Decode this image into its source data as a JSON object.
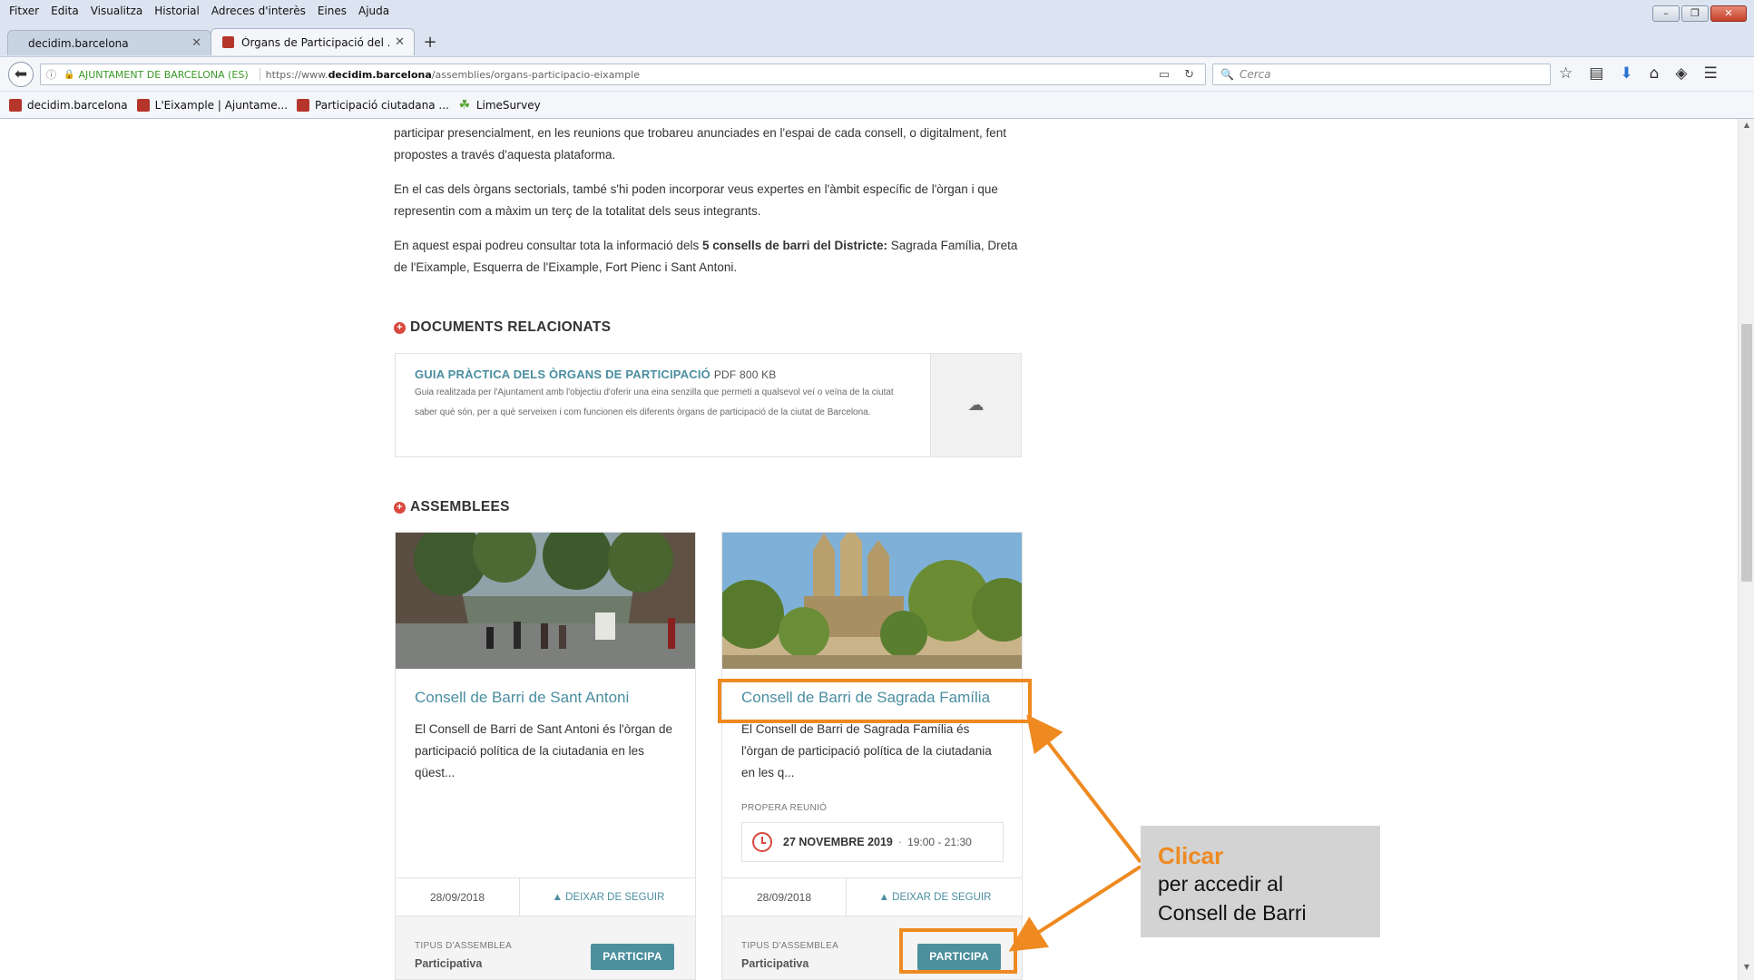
{
  "browser": {
    "menu": [
      "Fitxer",
      "Edita",
      "Visualitza",
      "Historial",
      "Adreces d'interès",
      "Eines",
      "Ajuda"
    ],
    "tabs": [
      {
        "title": "decidim.barcelona",
        "active": false
      },
      {
        "title": "Òrgans de Participació del ...",
        "active": true
      }
    ],
    "url": {
      "identity": "AJUNTAMENT DE BARCELONA (ES)",
      "prefix": "https://www.",
      "host": "decidim.barcelona",
      "path": "/assemblies/organs-participacio-eixample"
    },
    "search_placeholder": "Cerca",
    "bookmarks": [
      "decidim.barcelona",
      "L'Eixample | Ajuntame...",
      "Participació ciutadana ...",
      "LimeSurvey"
    ]
  },
  "intro": {
    "p1": "participar presencialment, en les reunions que trobareu anunciades en l'espai de cada consell, o digitalment, fent propostes a través d'aquesta plataforma.",
    "p2": "En el cas dels òrgans sectorials, també s'hi poden incorporar veus expertes en l'àmbit específic de l'òrgan i que representin com a màxim un terç de la totalitat dels seus integrants.",
    "p3_a": "En aquest espai podreu consultar tota la informació dels ",
    "p3_b": "5 consells de barri del Districte:",
    "p3_c": " Sagrada Família, Dreta de l'Eixample, Esquerra de l'Eixample, Fort Pienc i Sant Antoni."
  },
  "documents": {
    "heading": "DOCUMENTS RELACIONATS",
    "title": "GUIA PRÀCTICA DELS ÒRGANS DE PARTICIPACIÓ",
    "format": "PDF 800 KB",
    "description": "Guia realitzada per l'Ajuntament amb l'objectiu d'oferir una eina senzilla que permeti a qualsevol veí o veïna de la ciutat saber què són, per a què serveixen i com funcionen els diferents òrgans de participació de la ciutat de Barcelona."
  },
  "assemblies": {
    "heading": "ASSEMBLEES",
    "cards": [
      {
        "title": "Consell de Barri de Sant Antoni",
        "description": "El Consell de Barri de Sant Antoni és l'òrgan de participació política de la ciutadania en les qüest...",
        "date": "28/09/2018",
        "follow": "DEIXAR DE SEGUIR",
        "type_label": "TIPUS D'ASSEMBLEA",
        "type_value": "Participativa",
        "button": "PARTICIPA"
      },
      {
        "title": "Consell de Barri de Sagrada Família",
        "description": "El Consell de Barri de Sagrada Família és l'òrgan de participació política de la ciutadania en les q...",
        "next_label": "PROPERA REUNIÓ",
        "next_date": "27 NOVEMBRE 2019",
        "next_time": "19:00 - 21:30",
        "date": "28/09/2018",
        "follow": "DEIXAR DE SEGUIR",
        "type_label": "TIPUS D'ASSEMBLEA",
        "type_value": "Participativa",
        "button": "PARTICIPA"
      }
    ]
  },
  "annotation": {
    "headline": "Clicar",
    "line1": "per accedir al",
    "line2": "Consell de Barri",
    "accent_color": "#ee8a20"
  }
}
